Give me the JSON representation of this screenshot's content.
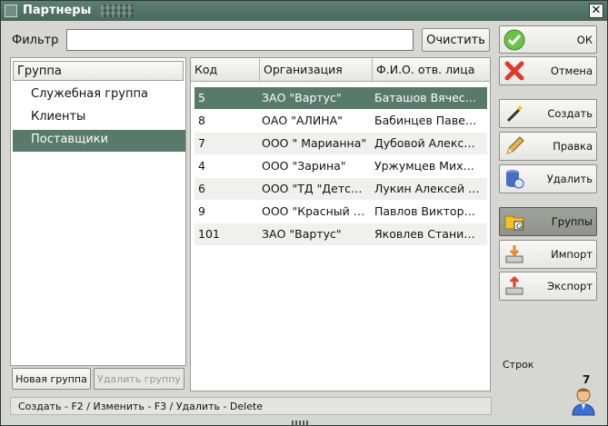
{
  "window": {
    "title": "Партнеры",
    "close_glyph": "✕"
  },
  "filter": {
    "label": "Фильтр",
    "value": "",
    "clear_label": "Очистить"
  },
  "groups": {
    "header": "Группа",
    "items": [
      {
        "label": "Служебная группа",
        "selected": false
      },
      {
        "label": "Клиенты",
        "selected": false
      },
      {
        "label": "Поставщики",
        "selected": true
      }
    ],
    "new_label": "Новая группа",
    "delete_label": "Удалить группу"
  },
  "table": {
    "columns": [
      "Код",
      "Организация",
      "Ф.И.О. отв. лица"
    ],
    "rows": [
      {
        "code": "5",
        "org": "ЗАО \"Вартус\"",
        "person": "Баташов Вячес…",
        "selected": true
      },
      {
        "code": "8",
        "org": "ОАО \"АЛИНА\"",
        "person": "Бабинцев Паве…"
      },
      {
        "code": "7",
        "org": "ООО \" Марианна\"",
        "person": "Дубовой Алекс…"
      },
      {
        "code": "4",
        "org": "ООО \"Зарина\"",
        "person": "Уржумцев Мих…"
      },
      {
        "code": "6",
        "org": "ООО \"ТД \"Детс…",
        "person": "Лукин Алексей …"
      },
      {
        "code": "9",
        "org": "ООО \"Красный …",
        "person": "Павлов Виктор…"
      },
      {
        "code": "101",
        "org": "ЗАО \"Вартус\"",
        "person": "Яковлев Стани…"
      }
    ]
  },
  "actions": {
    "ok": "ОК",
    "cancel": "Отмена",
    "create": "Создать",
    "edit": "Правка",
    "delete": "Удалить",
    "groups": "Группы",
    "import": "Импорт",
    "export": "Экспорт"
  },
  "rows_label": "Строк",
  "rows_count": "7",
  "status": "Создать - F2 / Изменить - F3 / Удалить - Delete",
  "colors": {
    "selection": "#587a6b",
    "titlebar": "#48695d"
  }
}
